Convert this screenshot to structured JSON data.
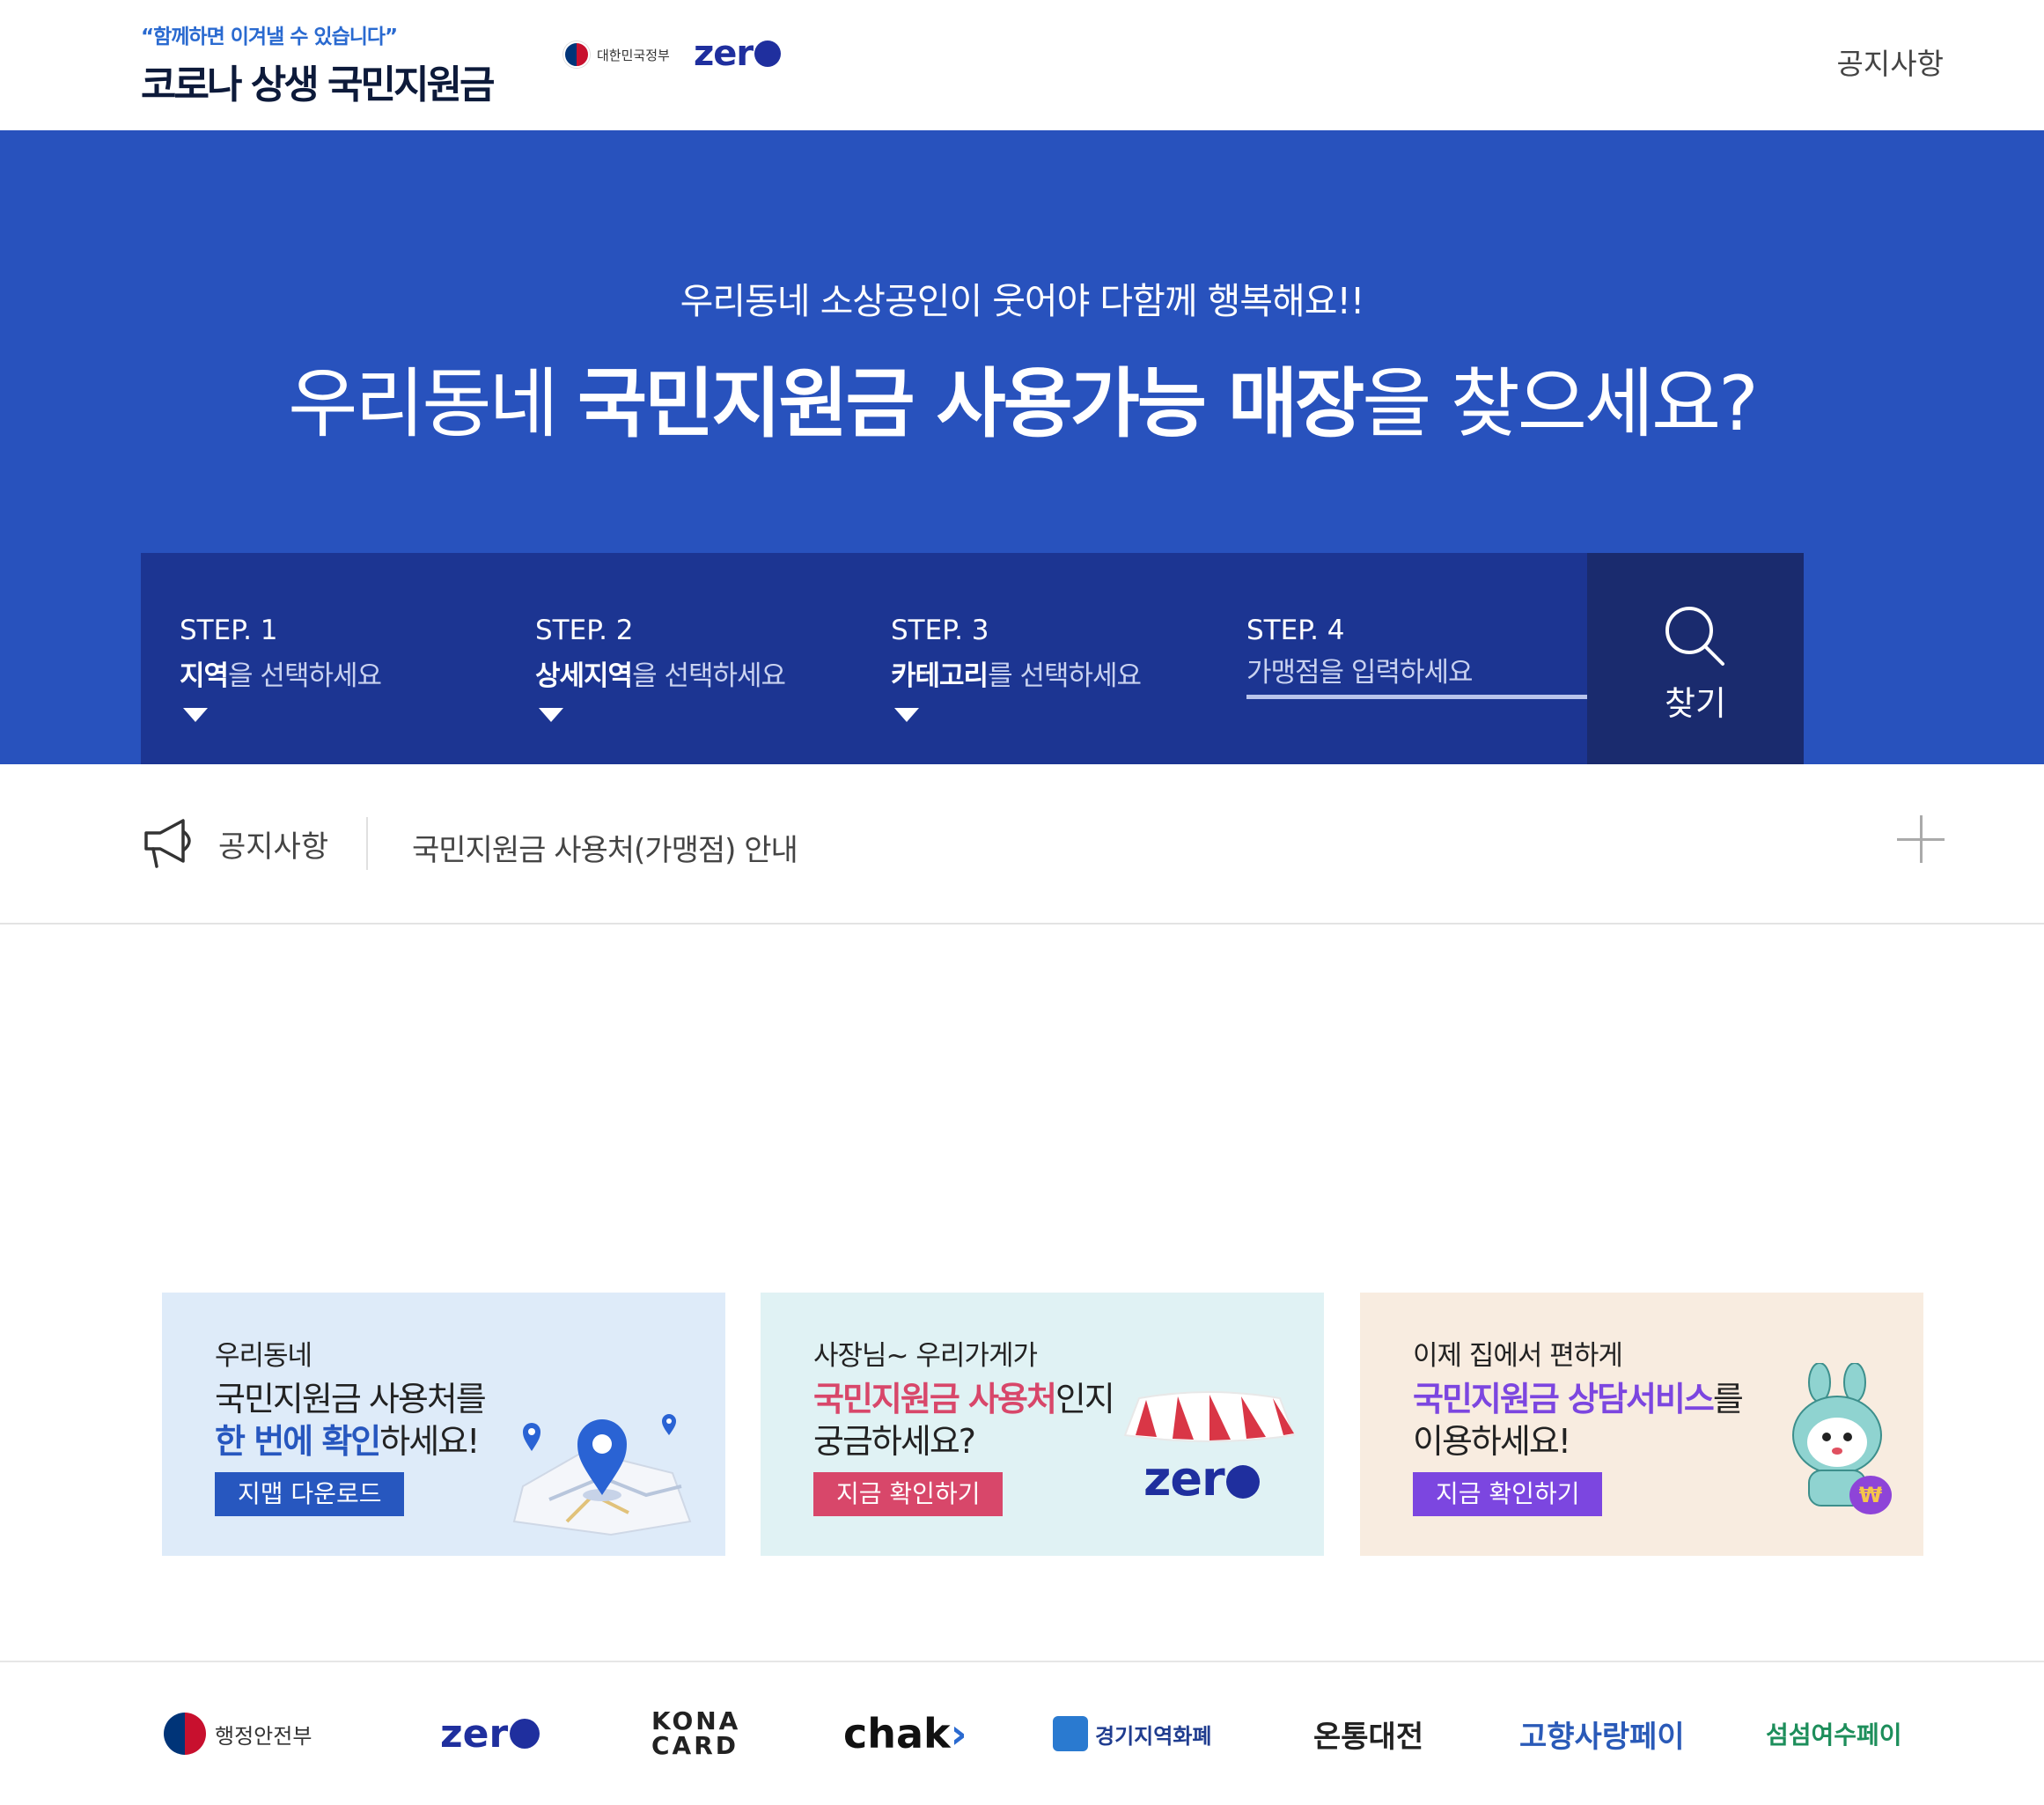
{
  "header": {
    "logo_tagline": "“함께하면 이겨낼 수 있습니다”",
    "logo_title": "코로나 상생 국민지원금",
    "gov_label": "대한민국정부",
    "zero_logo": "zer",
    "notice_link": "공지사항"
  },
  "hero": {
    "subtitle": "우리동네 소상공인이 웃어야 다함께 행복해요!!",
    "title_pre": "우리동네 ",
    "title_bold": "국민지원금 사용가능 매장",
    "title_post": "을 찾으세요?"
  },
  "search": {
    "steps": [
      {
        "label": "STEP. 1",
        "bold": "지역",
        "rest": "을 선택하세요"
      },
      {
        "label": "STEP. 2",
        "bold": "상세지역",
        "rest": "을 선택하세요"
      },
      {
        "label": "STEP. 3",
        "bold": "카테고리",
        "rest": "를 선택하세요"
      },
      {
        "label": "STEP. 4",
        "placeholder": "가맹점을 입력하세요"
      }
    ],
    "button_label": "찾기"
  },
  "notice": {
    "title": "공지사항",
    "text": "국민지원금 사용처(가맹점) 안내"
  },
  "banners": [
    {
      "line1": "우리동네",
      "line2": "국민지원금 사용처를",
      "line3_hl": "한 번에 확인",
      "line3_rest": "하세요!",
      "button": "지맵 다운로드"
    },
    {
      "line1": "사장님~ 우리가게가",
      "line2_hl": "국민지원금 사용처",
      "line2_rest": "인지",
      "line3": "궁금하세요?",
      "button": "지금 확인하기",
      "logo": "zer"
    },
    {
      "line1": "이제 집에서 편하게",
      "line2_hl": "국민지원금 상담서비스",
      "line2_rest": "를",
      "line3": "이용하세요!",
      "button": "지금 확인하기"
    }
  ],
  "partners": {
    "mois": "행정안전부",
    "zero": "zer",
    "kona_1": "KONA",
    "kona_2": "CARD",
    "chak": "chak",
    "chak_arrow": "›",
    "gyeonggi": "경기지역화폐",
    "ontong": "온통대전",
    "gohyang": "고향사랑페이",
    "yeosu": "섬섬여수페이"
  },
  "colors": {
    "hero_bg": "#2852bd",
    "search_bg": "#1c3592",
    "search_button_bg": "#1a2b6e",
    "accent_blue": "#2757bf",
    "accent_red": "#d8476a",
    "accent_purple": "#7c46e0"
  },
  "icons": {
    "search": "search-icon",
    "megaphone": "megaphone-icon",
    "plus": "plus-icon",
    "dropdown": "caret-down-icon"
  }
}
